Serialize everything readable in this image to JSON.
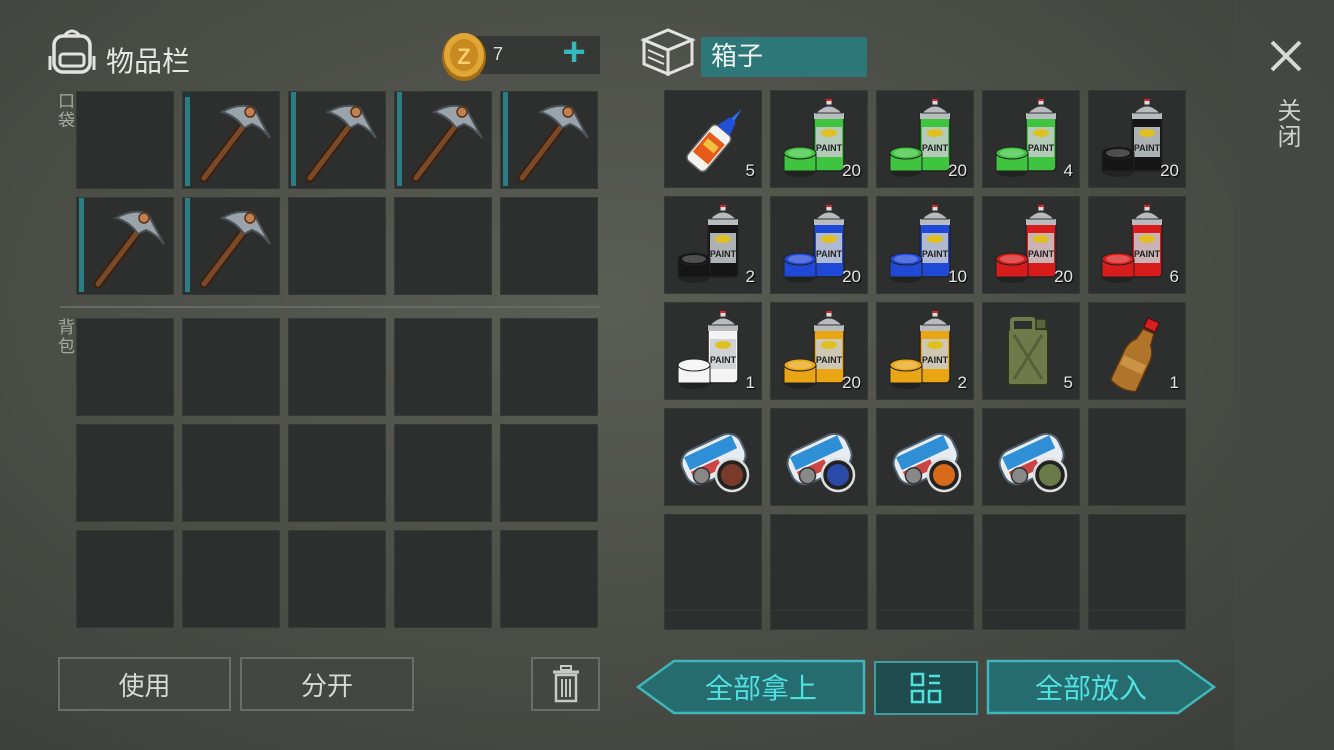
{
  "inventory": {
    "title": "物品栏",
    "currency_amount": "7",
    "add_symbol": "+",
    "pocket_label": "口袋",
    "backpack_label": "背包",
    "pocket_slots": [
      {
        "item": "",
        "icon": ""
      },
      {
        "item": "pickaxe",
        "icon": "pickaxe-icon",
        "durability": 0.95
      },
      {
        "item": "pickaxe",
        "icon": "pickaxe-icon",
        "durability": 1.0
      },
      {
        "item": "pickaxe",
        "icon": "pickaxe-icon",
        "durability": 1.0
      },
      {
        "item": "pickaxe",
        "icon": "pickaxe-icon",
        "durability": 1.0
      },
      {
        "item": "pickaxe",
        "icon": "pickaxe-icon",
        "durability": 1.0
      },
      {
        "item": "pickaxe",
        "icon": "pickaxe-icon",
        "durability": 1.0
      },
      {
        "item": "",
        "icon": ""
      },
      {
        "item": "",
        "icon": ""
      },
      {
        "item": "",
        "icon": ""
      }
    ],
    "backpack_slot_count": 15
  },
  "box": {
    "title": "箱子",
    "slots": [
      {
        "icon": "glue-icon",
        "qty": "5"
      },
      {
        "icon": "spray-paint-icon",
        "color": "#3ec43e",
        "qty": "20"
      },
      {
        "icon": "spray-paint-icon",
        "color": "#3ec43e",
        "qty": "20"
      },
      {
        "icon": "spray-paint-icon",
        "color": "#3ec43e",
        "qty": "4"
      },
      {
        "icon": "spray-paint-icon",
        "color": "#151515",
        "qty": "20"
      },
      {
        "icon": "spray-paint-icon",
        "color": "#151515",
        "qty": "2"
      },
      {
        "icon": "spray-paint-icon",
        "color": "#1f49d6",
        "qty": "20"
      },
      {
        "icon": "spray-paint-icon",
        "color": "#1f49d6",
        "qty": "10"
      },
      {
        "icon": "spray-paint-icon",
        "color": "#d81c1c",
        "qty": "20"
      },
      {
        "icon": "spray-paint-icon",
        "color": "#d81c1c",
        "qty": "6"
      },
      {
        "icon": "spray-paint-icon",
        "color": "#f4f4f4",
        "qty": "1"
      },
      {
        "icon": "spray-paint-icon",
        "color": "#e9a514",
        "qty": "20"
      },
      {
        "icon": "spray-paint-icon",
        "color": "#e9a514",
        "qty": "2"
      },
      {
        "icon": "jerrycan-icon",
        "qty": "5"
      },
      {
        "icon": "bottle-icon",
        "qty": "1"
      },
      {
        "icon": "magazine-icon",
        "badge": "#7a3a2a",
        "qty": ""
      },
      {
        "icon": "magazine-icon",
        "badge": "#2a4aa8",
        "qty": ""
      },
      {
        "icon": "magazine-icon",
        "badge": "#d96a1a",
        "qty": ""
      },
      {
        "icon": "magazine-icon",
        "badge": "#6b7a4a",
        "qty": ""
      },
      {
        "icon": "",
        "qty": ""
      },
      {
        "icon": "",
        "qty": ""
      },
      {
        "icon": "",
        "qty": ""
      },
      {
        "icon": "",
        "qty": ""
      },
      {
        "icon": "",
        "qty": ""
      },
      {
        "icon": "",
        "qty": ""
      }
    ]
  },
  "buttons": {
    "use": "使用",
    "split": "分开",
    "take_all": "全部拿上",
    "put_all": "全部放入"
  },
  "close": {
    "label": "关闭"
  }
}
